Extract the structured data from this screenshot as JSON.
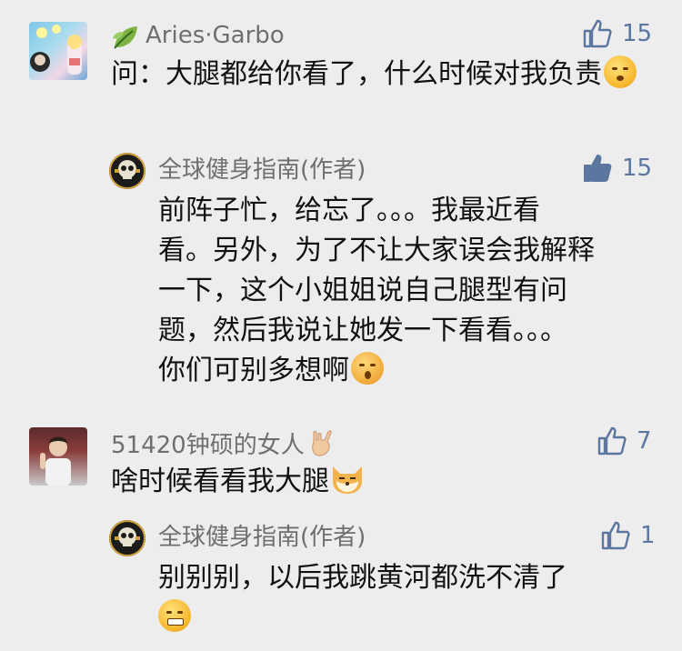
{
  "comments": [
    {
      "author": "Aries·Garbo",
      "likes": "15",
      "text": "问：大腿都给你看了，什么时候对我负责",
      "liked": false,
      "reply": {
        "author": "全球健身指南(作者)",
        "likes": "15",
        "liked": true,
        "text_lines": [
          "前阵子忙，给忘了。。。我最近看",
          "看。另外，为了不让大家误会我解释",
          "一下，这个小姐姐说自己腿型有问",
          "题，然后我说让她发一下看看。。。",
          "你们可别多想啊"
        ]
      }
    },
    {
      "author": "51420钟硕的女人",
      "likes": "7",
      "text": "啥时候看看我大腿",
      "liked": false,
      "reply": {
        "author": "全球健身指南(作者)",
        "likes": "1",
        "liked": false,
        "text": "别别别，以后我跳黄河都洗不清了"
      }
    }
  ],
  "colors": {
    "background": "#ededed",
    "name": "#6f6f6f",
    "like": "#5b77a0",
    "text": "#111111"
  },
  "icons": [
    "leaf-icon",
    "thumbs-up-icon",
    "thumbs-up-filled-icon",
    "rock-hand-emoji",
    "blush-emoji",
    "kiss-emoji",
    "shiba-emoji",
    "grimace-emoji"
  ]
}
